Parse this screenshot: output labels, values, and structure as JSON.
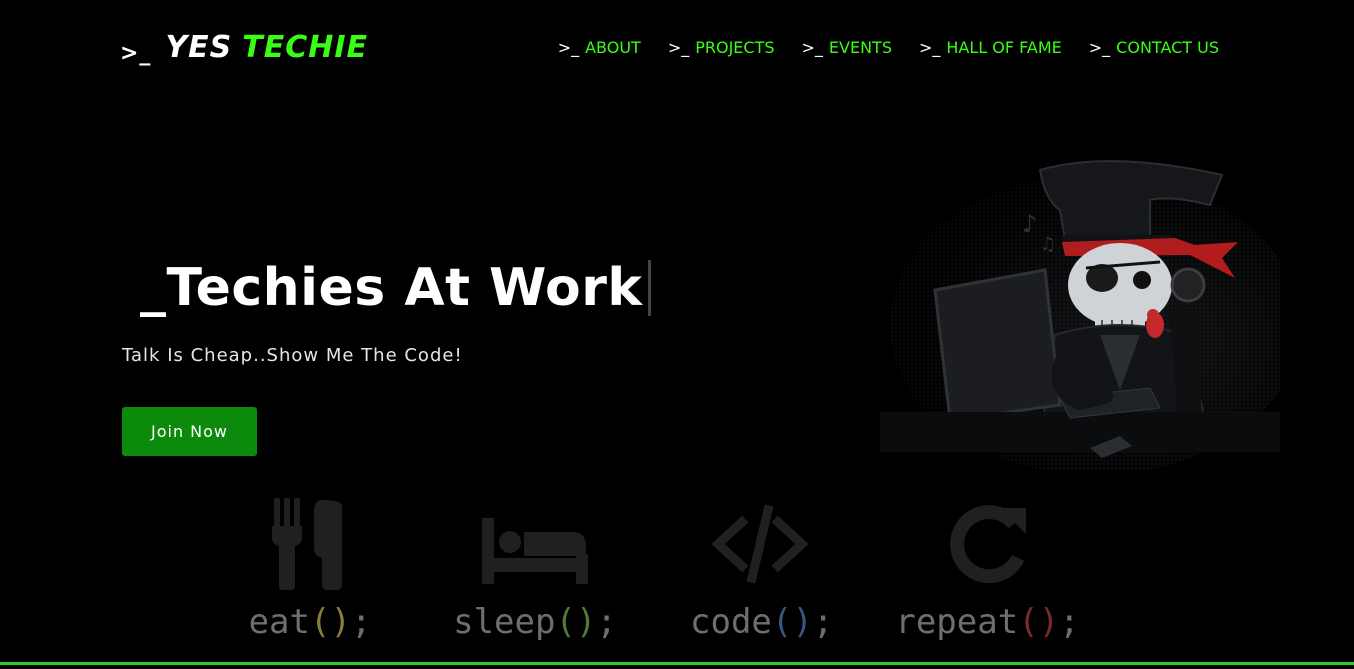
{
  "header": {
    "logo_prompt": ">_",
    "logo_word1": "YES",
    "logo_word2": "TECHIE",
    "nav_prompt": ">_",
    "nav": [
      {
        "label": "ABOUT"
      },
      {
        "label": "PROJECTS"
      },
      {
        "label": "EVENTS"
      },
      {
        "label": "HALL OF FAME"
      },
      {
        "label": "CONTACT US"
      }
    ]
  },
  "hero": {
    "title": "_Techies At Work",
    "subtitle": "Talk Is Cheap..Show Me The Code!",
    "join_label": "Join Now"
  },
  "motto": [
    {
      "name": "eat",
      "icon": "fork-knife-icon",
      "paren_color": "#8a7d3a"
    },
    {
      "name": "sleep",
      "icon": "bed-icon",
      "paren_color": "#4e7a3a"
    },
    {
      "name": "code",
      "icon": "code-brackets-icon",
      "paren_color": "#36557f"
    },
    {
      "name": "repeat",
      "icon": "redo-arrow-icon",
      "paren_color": "#7a2b2b"
    }
  ],
  "colors": {
    "accent": "#39ff14",
    "button": "#0b8a0b",
    "background": "#000000"
  }
}
